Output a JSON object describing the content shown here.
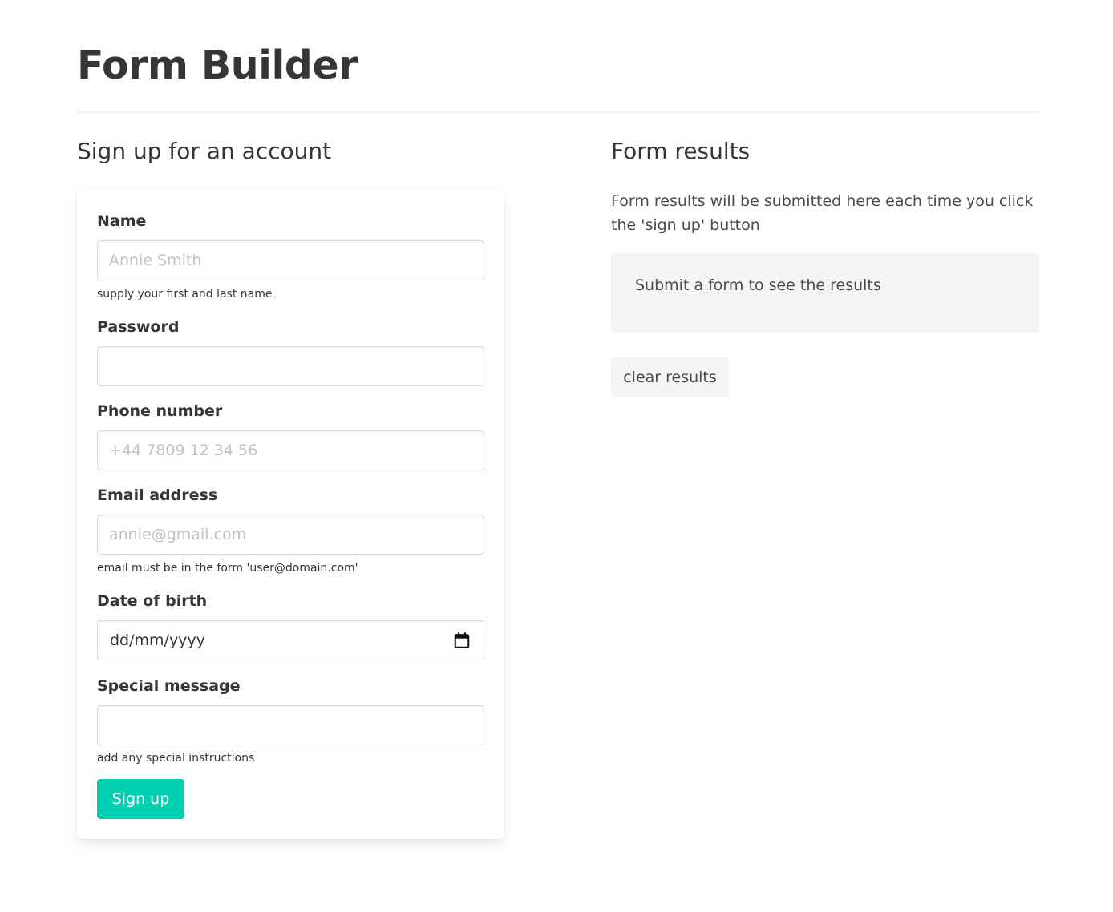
{
  "page": {
    "title": "Form Builder"
  },
  "signup_form": {
    "heading": "Sign up for an account",
    "fields": {
      "name": {
        "label": "Name",
        "placeholder": "Annie Smith",
        "value": "",
        "help": "supply your first and last name"
      },
      "password": {
        "label": "Password",
        "placeholder": "",
        "value": ""
      },
      "phone": {
        "label": "Phone number",
        "placeholder": "+44 7809 12 34 56",
        "value": ""
      },
      "email": {
        "label": "Email address",
        "placeholder": "annie@gmail.com",
        "value": "",
        "help": "email must be in the form 'user@domain.com'"
      },
      "dob": {
        "label": "Date of birth",
        "value": "dd/mm/yyyy",
        "icon": "calendar-icon"
      },
      "message": {
        "label": "Special message",
        "placeholder": "",
        "value": "",
        "help": "add any special instructions"
      }
    },
    "submit_label": "Sign up"
  },
  "results": {
    "heading": "Form results",
    "intro": "Form results will be submitted here each time you click the 'sign up' button",
    "box_text": "Submit a form to see the results",
    "clear_label": "clear results"
  },
  "colors": {
    "primary": "#00d1b2",
    "text": "#363636",
    "muted_bg": "#f5f5f5",
    "border": "#dbdbdb"
  }
}
